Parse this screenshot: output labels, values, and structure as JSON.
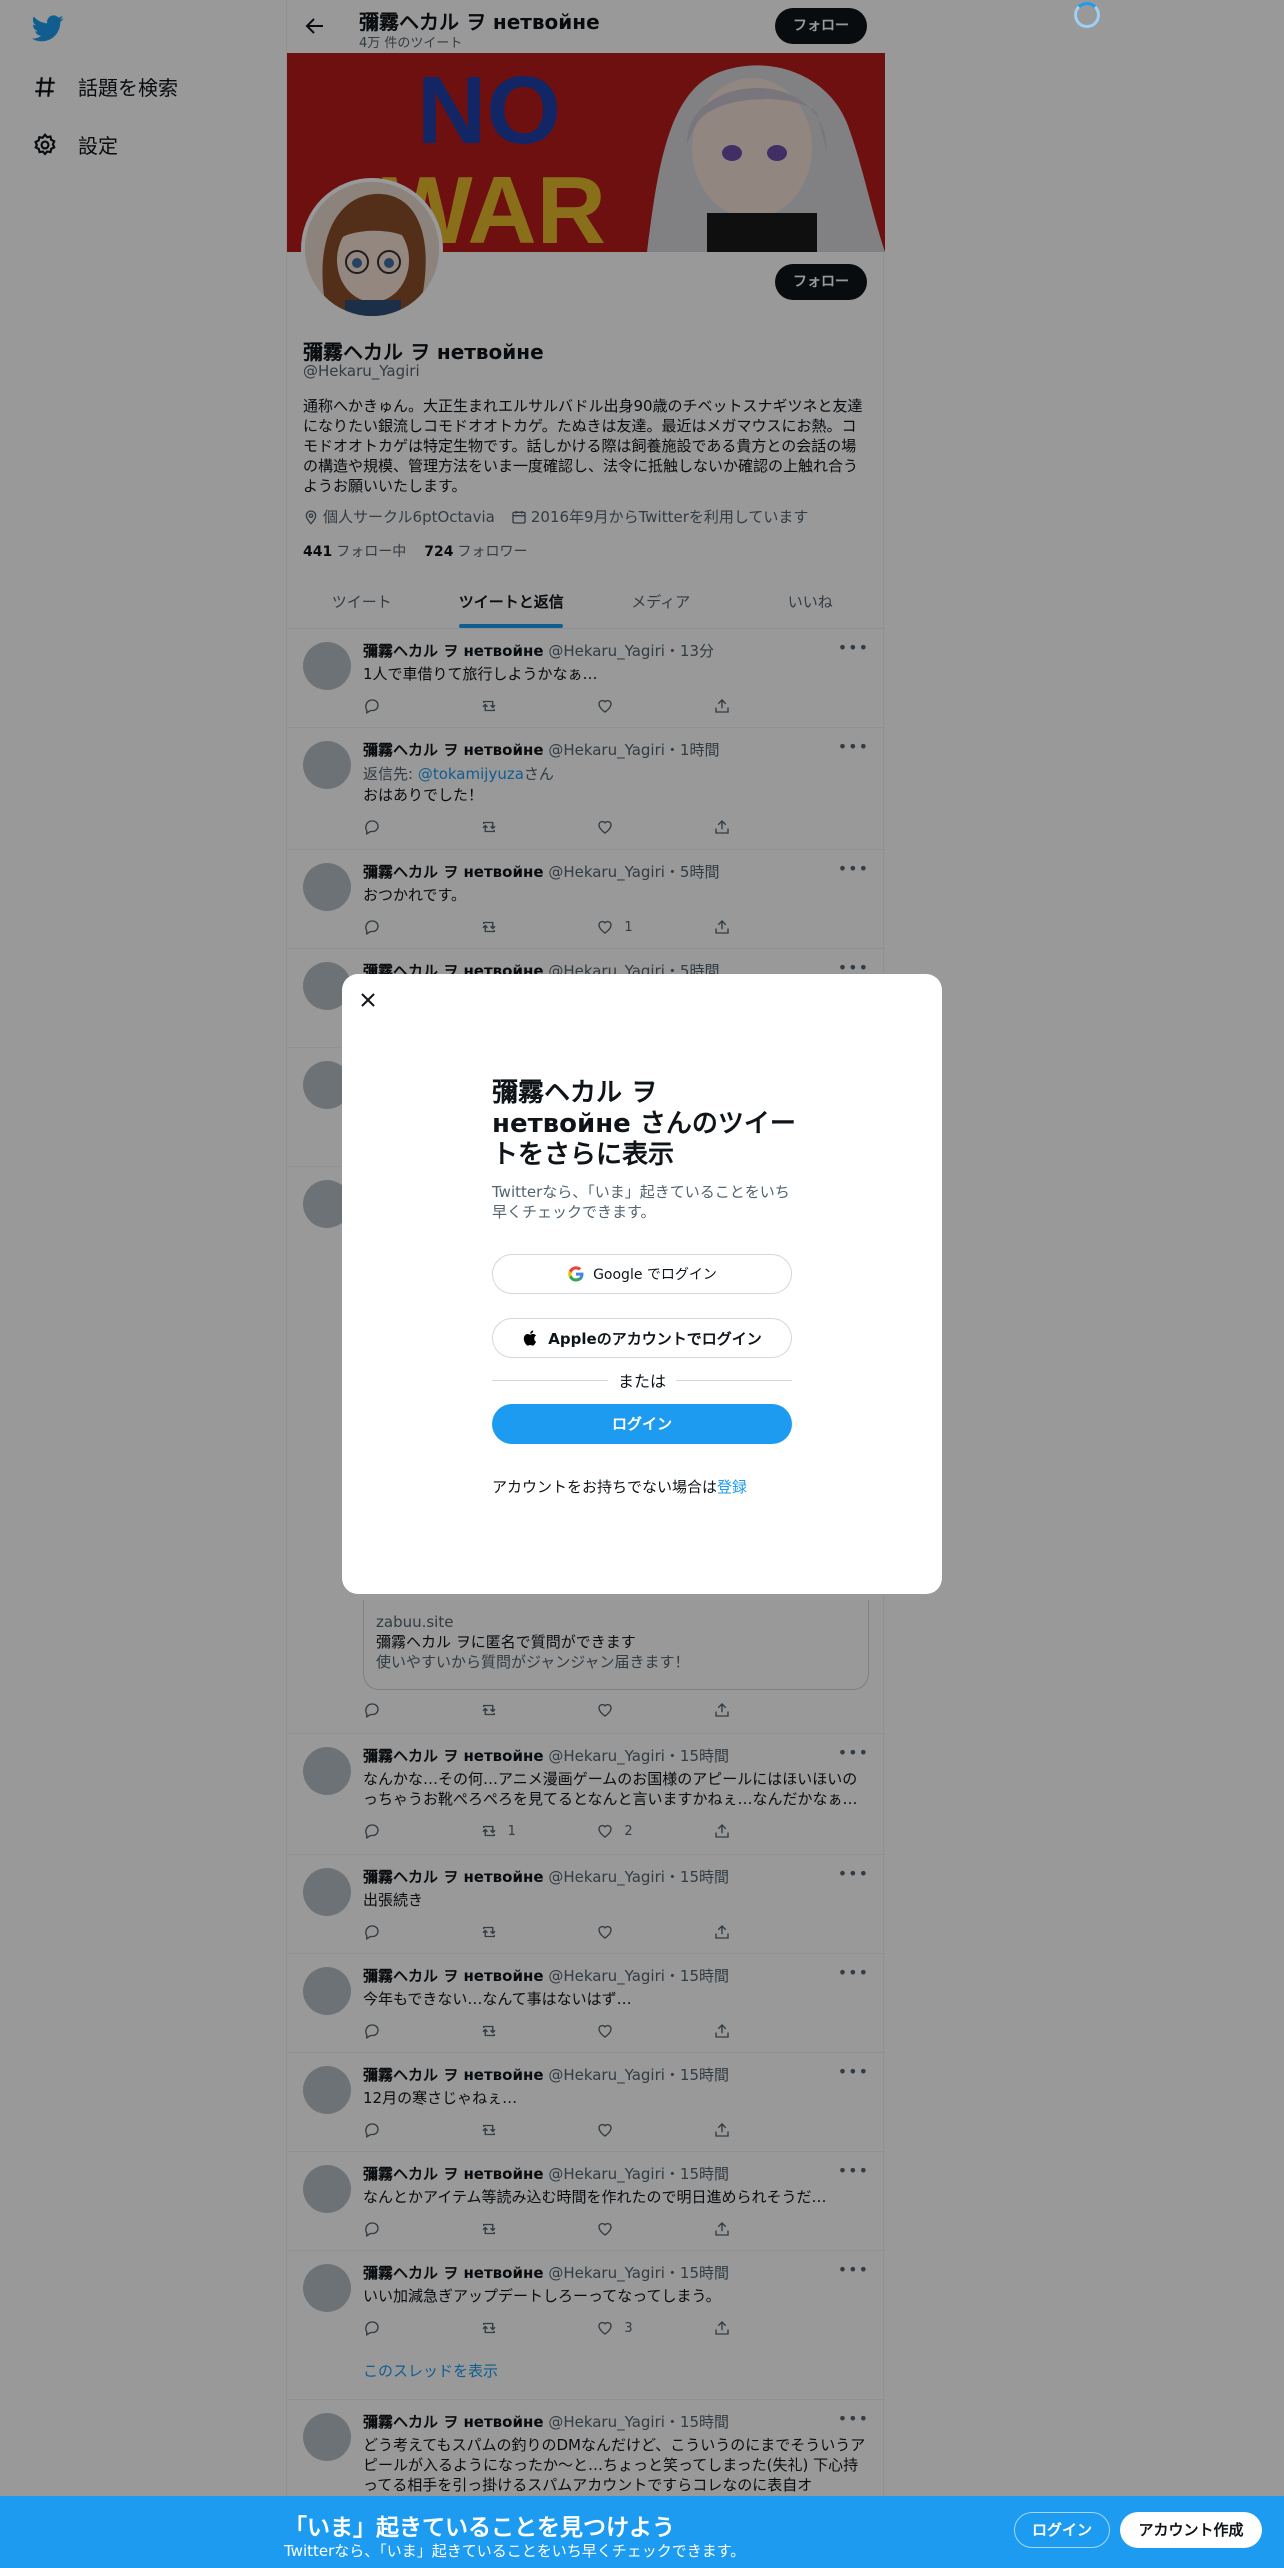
{
  "colors": {
    "accent": "#1d9bf0",
    "dark": "#0f1419",
    "muted": "#536471"
  },
  "nav": {
    "logo_icon": "twitter-bird-icon",
    "items": [
      {
        "icon": "hashtag-icon",
        "label": "話題を検索"
      },
      {
        "icon": "gear-icon",
        "label": "設定"
      }
    ]
  },
  "header": {
    "title": "彌霧ヘカル ヲ нетвойне",
    "subtitle": "4万 件のツイート",
    "follow_label": "フォロー"
  },
  "banner": {
    "text_1": "NO",
    "text_2": "WAR"
  },
  "profile": {
    "name": "彌霧ヘカル ヲ нетвойне",
    "handle": "@Hekaru_Yagiri",
    "bio_lines": [
      "通称へかきゅん。大正生まれエルサルバドル出身90歳のチベットスナギツネと友達",
      "になりたい銀流しコモドオオトカゲ。たぬきは友達。最近はメガマウスにお熱。コ",
      "モドオオトカゲは特定生物です。話しかける際は飼養施設である貴方との会話の場",
      "の構造や規模、管理方法をいま一度確認し、法令に抵触しないか確認の上触れ合う",
      "ようお願いいたします。"
    ],
    "location": "個人サークル6ptOctavia",
    "joined": "2016年9月からTwitterを利用しています",
    "following_count": "441",
    "following_label": "フォロー中",
    "followers_count": "724",
    "followers_label": "フォロワー",
    "follow_label": "フォロー"
  },
  "tabs": [
    "ツイート",
    "ツイートと返信",
    "メディア",
    "いいね"
  ],
  "tweets": [
    {
      "name": "彌霧ヘカル ヲ нетвойне",
      "handle": "@Hekaru_Yagiri",
      "time": "・13分",
      "text": "1人で車借りて旅行しようかなぁ…",
      "retweets": "",
      "likes": ""
    },
    {
      "name": "彌霧ヘカル ヲ нетвойне",
      "handle": "@Hekaru_Yagiri",
      "time": "・1時間",
      "reply_prefix": "返信先: ",
      "reply_to": "@tokamijyuza",
      "reply_suffix": "さん",
      "text": "おはありでした！",
      "retweets": "",
      "likes": ""
    },
    {
      "name": "彌霧ヘカル ヲ нетвойне",
      "handle": "@Hekaru_Yagiri",
      "time": "・5時間",
      "text": "おつかれです。",
      "retweets": "",
      "likes": "1"
    },
    {
      "name": "彌霧ヘカル ヲ нетвойне",
      "handle": "@Hekaru_Yagiri",
      "time": "・5時間"
    },
    {
      "card_domain": "zabuu.site",
      "card_title": "彌霧ヘカル ヲに匿名で質問ができます",
      "card_desc": "使いやすいから質問がジャンジャン届きます！",
      "retweets": "",
      "likes": ""
    },
    {
      "name": "彌霧ヘカル ヲ нетвойне",
      "handle": "@Hekaru_Yagiri",
      "time": "・15時間",
      "text": "なんかな…その何…アニメ漫画ゲームのお国様のアピールにはほいほいのっちゃうお靴ぺろぺろを見てるとなんと言いますかねぇ…なんだかなぁ…",
      "retweets": "1",
      "likes": "2"
    },
    {
      "name": "彌霧ヘカル ヲ нетвойне",
      "handle": "@Hekaru_Yagiri",
      "time": "・15時間",
      "text": "出張続き",
      "retweets": "",
      "likes": ""
    },
    {
      "name": "彌霧ヘカル ヲ нетвойне",
      "handle": "@Hekaru_Yagiri",
      "time": "・15時間",
      "text": "今年もできない…なんて事はないはず…",
      "retweets": "",
      "likes": ""
    },
    {
      "name": "彌霧ヘカル ヲ нетвойне",
      "handle": "@Hekaru_Yagiri",
      "time": "・15時間",
      "text": "12月の寒さじゃねぇ…",
      "retweets": "",
      "likes": ""
    },
    {
      "name": "彌霧ヘカル ヲ нетвойне",
      "handle": "@Hekaru_Yagiri",
      "time": "・15時間",
      "text": "なんとかアイテム等読み込む時間を作れたので明日進められそうだ…",
      "retweets": "",
      "likes": ""
    },
    {
      "name": "彌霧ヘカル ヲ нетвойне",
      "handle": "@Hekaru_Yagiri",
      "time": "・15時間",
      "text": "いい加減急ぎアップデートしろーってなってしまう。",
      "retweets": "",
      "likes": "3",
      "thread_label": "このスレッドを表示"
    },
    {
      "name": "彌霧ヘカル ヲ нетвойне",
      "handle": "@Hekaru_Yagiri",
      "time": "・15時間",
      "text": "どう考えてもスパムの釣りのDMなんだけど、こういうのにまでそういうアピールが入るようになったか〜と…ちょっと笑ってしまった(失礼) 下心持ってる相手を引っ掛けるスパムアカウントですらコレなのに表自オ"
    }
  ],
  "modal": {
    "close_icon": "close-icon",
    "title": "彌霧ヘカル ヲ нетвойне さんのツイートをさらに表示",
    "subtitle": "Twitterなら、「いま」起きていることをいち早くチェックできます。",
    "google_label": "Google でログイン",
    "apple_label": "Appleのアカウントでログイン",
    "or_label": "または",
    "login_label": "ログイン",
    "signup_prefix": "アカウントをお持ちでない場合は",
    "signup_link": "登録"
  },
  "bottombar": {
    "title": "「いま」起きていることを見つけよう",
    "subtitle": "Twitterなら、「いま」起きていることをいち早くチェックできます。",
    "login_label": "ログイン",
    "signup_label": "アカウント作成"
  }
}
